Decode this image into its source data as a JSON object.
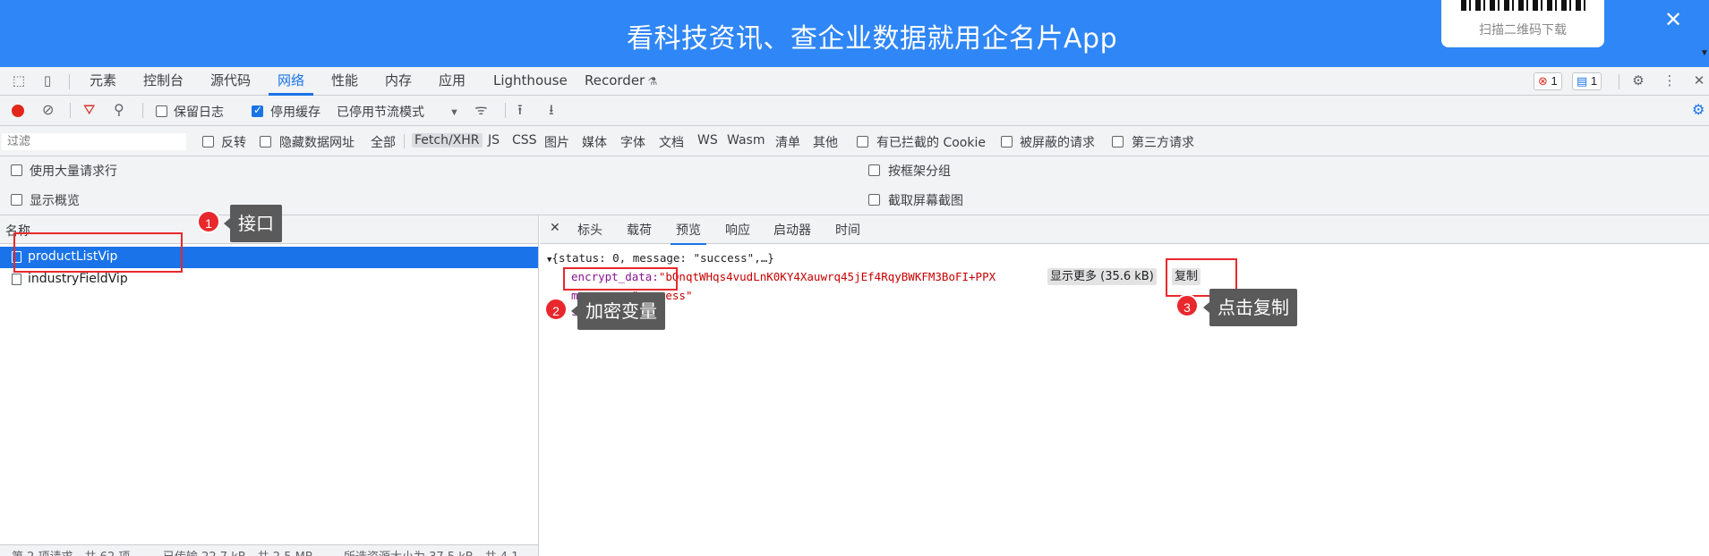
{
  "banner": {
    "title": "看科技资讯、查企业数据就用企名片App",
    "qr_caption": "扫描二维码下载",
    "close_icon": "close-icon",
    "color": "#2f86f6"
  },
  "devtools_tabs": [
    "元素",
    "控制台",
    "源代码",
    "网络",
    "性能",
    "内存",
    "应用",
    "Lighthouse",
    "Recorder"
  ],
  "active_tab": "网络",
  "badges": {
    "errors": "1",
    "messages": "1"
  },
  "toolbar": {
    "preserve_log": "保留日志",
    "disable_cache": "停用缓存",
    "throttle": "已停用节流模式"
  },
  "filter": {
    "placeholder": "过滤",
    "invert": "反转",
    "hide_data_urls": "隐藏数据网址",
    "types": [
      "全部",
      "Fetch/XHR",
      "JS",
      "CSS",
      "图片",
      "媒体",
      "字体",
      "文档",
      "WS",
      "Wasm",
      "清单",
      "其他"
    ],
    "active_type": "Fetch/XHR",
    "blocked_cookies": "有已拦截的 Cookie",
    "blocked_requests": "被屏蔽的请求",
    "third_party": "第三方请求"
  },
  "options": {
    "large_rows": "使用大量请求行",
    "group_by_frame": "按框架分组",
    "show_overview": "显示概览",
    "capture_screenshots": "截取屏幕截图"
  },
  "request_list": {
    "header": "名称",
    "rows": [
      "productListVip",
      "industryFieldVip"
    ],
    "status": [
      "第 2 项请求，共 62 项",
      "已传输 22.7 kB，共 2.5 MB",
      "所选资源大小为 37.5 kB，共 4.1"
    ]
  },
  "detail": {
    "close_icon": "close-icon",
    "tabs": [
      "标头",
      "载荷",
      "预览",
      "响应",
      "启动器",
      "时间"
    ],
    "active_tab": "预览",
    "summary": "{status: 0, message: \"success\",…}",
    "encrypt_key": "encrypt_data:",
    "encrypt_value": "\"bOnqtWHqs4vudLnK0KY4Xauwrq45jEf4RqyBWKFM3BoFI+PPX",
    "show_more": "显示更多 (35.6 kB)",
    "copy": "复制",
    "message_key": "message:",
    "message_value": "\"success\"",
    "status_key": "s"
  },
  "annotations": [
    {
      "num": "1",
      "label": "接口"
    },
    {
      "num": "2",
      "label": "加密变量"
    },
    {
      "num": "3",
      "label": "点击复制"
    }
  ]
}
